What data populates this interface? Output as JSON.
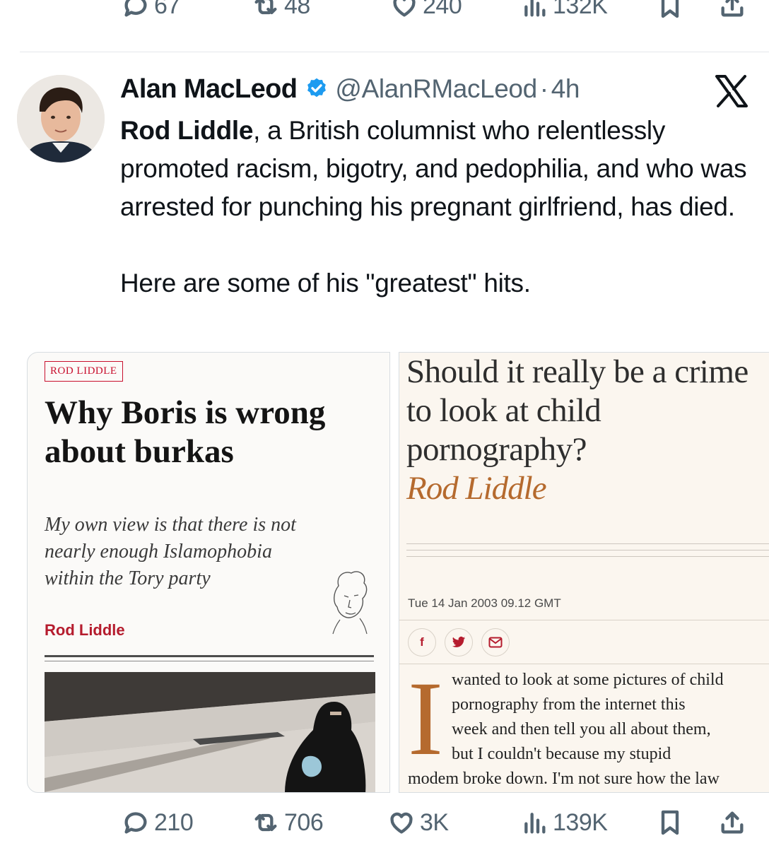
{
  "prev_tweet_actions": {
    "replies": "67",
    "reposts": "48",
    "likes": "240",
    "views": "132K"
  },
  "tweet": {
    "author_name": "Alan MacLeod",
    "handle": "@AlanRMacLeod",
    "separator": "·",
    "time": "4h",
    "text_bold": "Rod Liddle",
    "text_rest": ", a British columnist who relentlessly promoted racism, bigotry, and pedophilia, and who was arrested for punching his pregnant girlfriend, has died.",
    "text_second": "Here are some of his \"greatest\" hits."
  },
  "media_left": {
    "tag": "ROD LIDDLE",
    "headline": "Why Boris is wrong about burkas",
    "subhead": "My own view is that there is not nearly enough Islamophobia within the Tory party",
    "byline": "Rod Liddle"
  },
  "media_right": {
    "headline": "Should it really be a crime to look at child pornography?",
    "author": "Rod Liddle",
    "date": "Tue 14 Jan 2003 09.12 GMT",
    "share_facebook": "f",
    "dropcap": "I",
    "body_line1": "wanted to look at some pictures of child",
    "body_line2": "pornography from the internet this",
    "body_line3": "week and then tell you all about them,",
    "body_line4": "but I couldn't because my stupid",
    "body_line5": "modem broke down. I'm not sure how the law"
  },
  "tweet_actions": {
    "replies": "210",
    "reposts": "706",
    "likes": "3K",
    "views": "139K"
  },
  "colors": {
    "text": "#0f1419",
    "secondary": "#536471",
    "verified": "#1d9bf0",
    "accent_red": "#c8102e",
    "guardian_orange": "#b56a2e"
  },
  "icons": [
    "reply-icon",
    "repost-icon",
    "like-icon",
    "views-icon",
    "bookmark-icon",
    "share-icon",
    "verified-badge-icon",
    "x-logo-icon"
  ]
}
